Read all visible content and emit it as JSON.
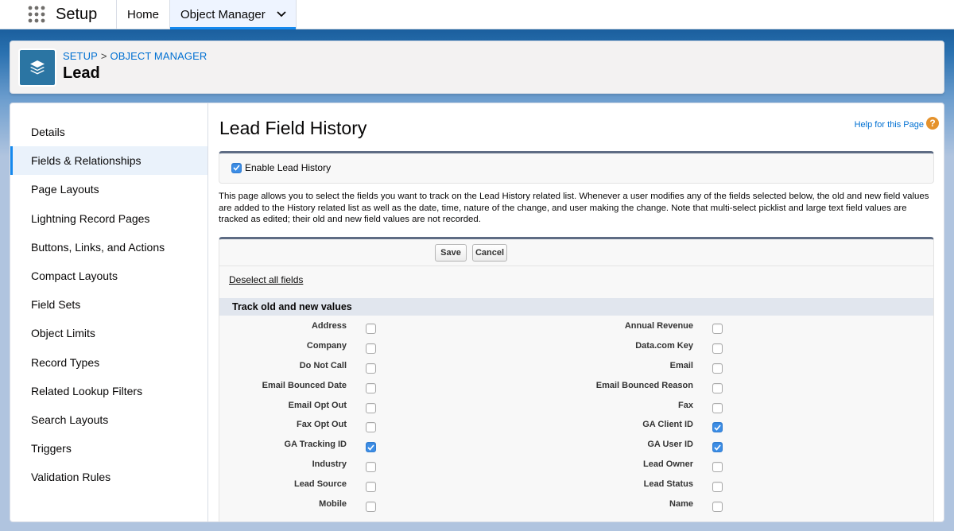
{
  "topbar": {
    "app_name": "Setup",
    "tabs": [
      {
        "label": "Home"
      },
      {
        "label": "Object Manager"
      }
    ]
  },
  "header": {
    "breadcrumb": [
      "SETUP",
      "OBJECT MANAGER"
    ],
    "breadcrumb_separator": ">",
    "title": "Lead"
  },
  "sidebar": {
    "items": [
      {
        "label": "Details"
      },
      {
        "label": "Fields & Relationships",
        "active": true
      },
      {
        "label": "Page Layouts"
      },
      {
        "label": "Lightning Record Pages"
      },
      {
        "label": "Buttons, Links, and Actions"
      },
      {
        "label": "Compact Layouts"
      },
      {
        "label": "Field Sets"
      },
      {
        "label": "Object Limits"
      },
      {
        "label": "Record Types"
      },
      {
        "label": "Related Lookup Filters"
      },
      {
        "label": "Search Layouts"
      },
      {
        "label": "Triggers"
      },
      {
        "label": "Validation Rules"
      }
    ]
  },
  "main": {
    "title": "Lead Field History",
    "help_link": "Help for this Page",
    "help_icon": "?",
    "enable": {
      "label": "Enable Lead History",
      "checked": true
    },
    "description": "This page allows you to select the fields you want to track on the Lead History related list. Whenever a user modifies any of the fields selected below, the old and new field values are added to the History related list as well as the date, time, nature of the change, and user making the change. Note that multi-select picklist and large text field values are tracked as edited; their old and new field values are not recorded.",
    "save_label": "Save",
    "cancel_label": "Cancel",
    "deselect_label": "Deselect all fields",
    "section_title": "Track old and new values",
    "fields": [
      {
        "left": "Address",
        "left_checked": false,
        "right": "Annual Revenue",
        "right_checked": false
      },
      {
        "left": "Company",
        "left_checked": false,
        "right": "Data.com Key",
        "right_checked": false
      },
      {
        "left": "Do Not Call",
        "left_checked": false,
        "right": "Email",
        "right_checked": false
      },
      {
        "left": "Email Bounced Date",
        "left_checked": false,
        "right": "Email Bounced Reason",
        "right_checked": false
      },
      {
        "left": "Email Opt Out",
        "left_checked": false,
        "right": "Fax",
        "right_checked": false
      },
      {
        "left": "Fax Opt Out",
        "left_checked": false,
        "right": "GA Client ID",
        "right_checked": true
      },
      {
        "left": "GA Tracking ID",
        "left_checked": true,
        "right": "GA User ID",
        "right_checked": true
      },
      {
        "left": "Industry",
        "left_checked": false,
        "right": "Lead Owner",
        "right_checked": false
      },
      {
        "left": "Lead Source",
        "left_checked": false,
        "right": "Lead Status",
        "right_checked": false
      },
      {
        "left": "Mobile",
        "left_checked": false,
        "right": "Name",
        "right_checked": false
      }
    ]
  },
  "icons": {
    "app_launcher": "waffle-icon",
    "tab_menu": "chevron-down-icon",
    "object": "layers-icon",
    "checkbox_check": "checkmark-icon"
  },
  "colors": {
    "accent": "#1589ee",
    "link": "#0070d2",
    "object_icon_bg": "#2b75a3",
    "checkbox_checked": "#3d8ee6",
    "help_icon": "#e5922c"
  }
}
